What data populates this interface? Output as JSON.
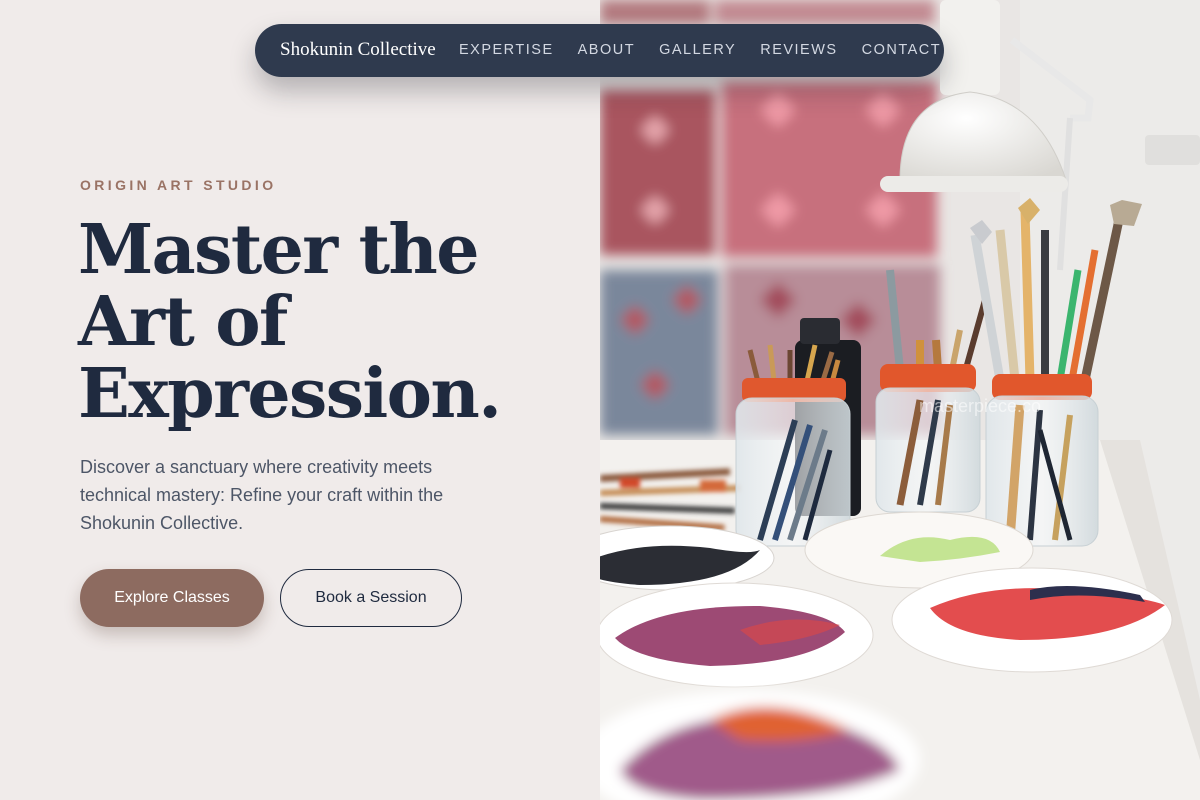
{
  "nav": {
    "brand": "Shokunin Collective",
    "links": [
      "EXPERTISE",
      "ABOUT",
      "GALLERY",
      "REVIEWS",
      "CONTACT"
    ]
  },
  "hero": {
    "eyebrow": "ORIGIN ART STUDIO",
    "title_lines": [
      "Master the",
      "Art of",
      "Expression."
    ],
    "lede": "Discover a sanctuary where creativity meets technical mastery: Refine your craft within the Shokunin Collective.",
    "primary_cta": "Explore Classes",
    "secondary_cta": "Book a Session"
  },
  "photo": {
    "watermark": "masterpiece.co"
  },
  "colors": {
    "page_bg": "#f0ebea",
    "nav_bg": "#2f3a4e",
    "heading": "#1f2a3f",
    "accent": "#8d6b60",
    "eyebrow": "#9a7365"
  }
}
